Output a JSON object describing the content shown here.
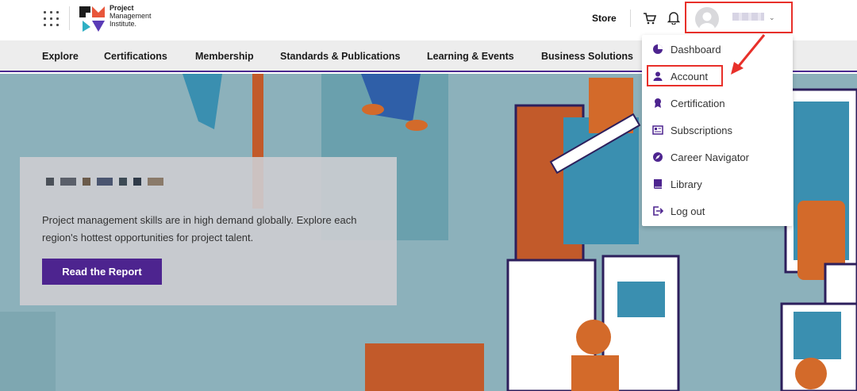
{
  "header": {
    "logo_lines": [
      "Project",
      "Management",
      "Institute."
    ],
    "store_label": "Store"
  },
  "nav": {
    "items": [
      {
        "label": "Explore"
      },
      {
        "label": "Certifications"
      },
      {
        "label": "Membership"
      },
      {
        "label": "Standards & Publications"
      },
      {
        "label": "Learning & Events"
      },
      {
        "label": "Business Solutions"
      }
    ]
  },
  "hero": {
    "description": "Project management skills are in high demand globally. Explore each region's hottest opportunities for project talent.",
    "cta_label": "Read the Report"
  },
  "user_menu": {
    "items": [
      {
        "label": "Dashboard",
        "icon": "pie-chart-icon"
      },
      {
        "label": "Account",
        "icon": "user-icon"
      },
      {
        "label": "Certification",
        "icon": "badge-icon"
      },
      {
        "label": "Subscriptions",
        "icon": "newsletter-icon"
      },
      {
        "label": "Career Navigator",
        "icon": "compass-icon"
      },
      {
        "label": "Library",
        "icon": "book-icon"
      },
      {
        "label": "Log out",
        "icon": "logout-icon"
      }
    ]
  },
  "colors": {
    "brand_purple": "#4d248f",
    "annotation_red": "#e8302a",
    "hero_background": "#8cb1bb"
  }
}
